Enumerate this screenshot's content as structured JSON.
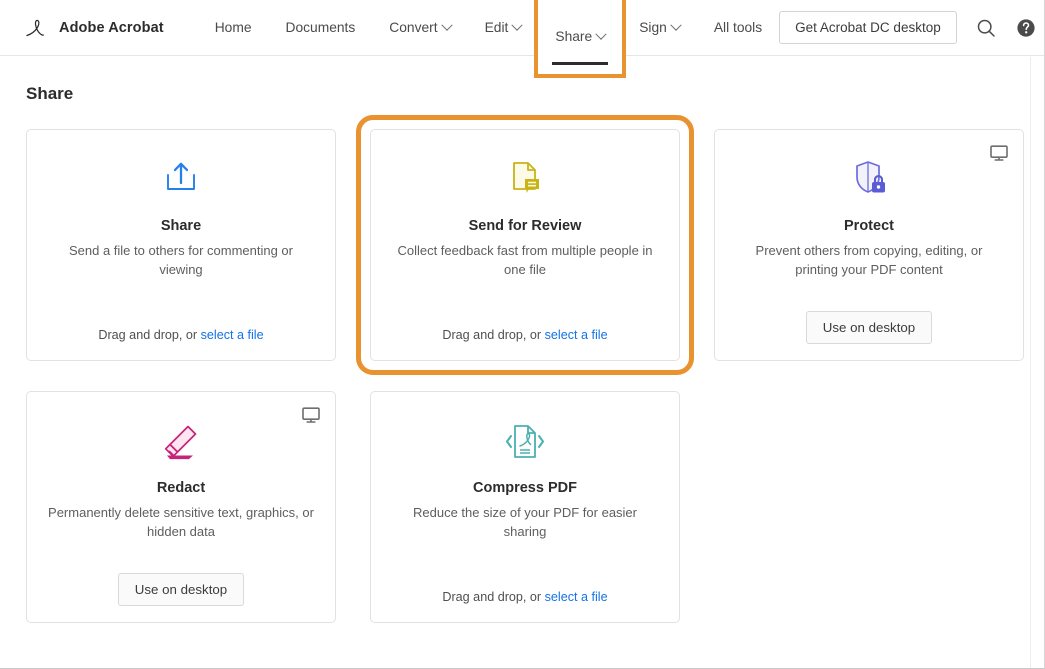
{
  "header": {
    "brand": {
      "logo_icon": "acrobat-logo-icon",
      "name": "Adobe Acrobat"
    },
    "nav": [
      {
        "label": "Home",
        "has_caret": false,
        "active": false,
        "highlighted": false
      },
      {
        "label": "Documents",
        "has_caret": false,
        "active": false,
        "highlighted": false
      },
      {
        "label": "Convert",
        "has_caret": true,
        "active": false,
        "highlighted": false
      },
      {
        "label": "Edit",
        "has_caret": true,
        "active": false,
        "highlighted": false
      },
      {
        "label": "Share",
        "has_caret": true,
        "active": true,
        "highlighted": true
      },
      {
        "label": "Sign",
        "has_caret": true,
        "active": false,
        "highlighted": false
      },
      {
        "label": "All tools",
        "has_caret": false,
        "active": false,
        "highlighted": false
      }
    ],
    "desktop_cta": "Get Acrobat DC desktop",
    "icons": {
      "search": "search-icon",
      "help": "help-icon",
      "notifications": "bell-icon",
      "avatar": "user-avatar"
    }
  },
  "main": {
    "title": "Share",
    "cards": [
      {
        "id": "share",
        "icon": "upload-share-icon",
        "title": "Share",
        "description": "Send a file to others for commenting or viewing",
        "footer_type": "dropzone",
        "dnd_text": "Drag and drop, or ",
        "dnd_link": "select a file",
        "desktop_badge": false,
        "highlighted": false
      },
      {
        "id": "send-for-review",
        "icon": "document-comment-icon",
        "title": "Send for Review",
        "description": "Collect feedback fast from multiple people in one file",
        "footer_type": "dropzone",
        "dnd_text": "Drag and drop, or ",
        "dnd_link": "select a file",
        "desktop_badge": false,
        "highlighted": true
      },
      {
        "id": "protect",
        "icon": "shield-lock-icon",
        "title": "Protect",
        "description": "Prevent others from copying, editing, or printing your PDF content",
        "footer_type": "button",
        "button_label": "Use on desktop",
        "desktop_badge": true,
        "badge_icon": "monitor-icon",
        "highlighted": false
      },
      {
        "id": "redact",
        "icon": "highlighter-marker-icon",
        "title": "Redact",
        "description": "Permanently delete sensitive text, graphics, or hidden data",
        "footer_type": "button",
        "button_label": "Use on desktop",
        "desktop_badge": true,
        "badge_icon": "monitor-icon",
        "highlighted": false
      },
      {
        "id": "compress-pdf",
        "icon": "compress-pdf-icon",
        "title": "Compress PDF",
        "description": "Reduce the size of your PDF for easier sharing",
        "footer_type": "dropzone",
        "dnd_text": "Drag and drop, or ",
        "dnd_link": "select a file",
        "desktop_badge": false,
        "highlighted": false
      }
    ]
  },
  "colors": {
    "highlight_orange": "#e8932f",
    "link_blue": "#1473e6",
    "share_icon_blue": "#2680eb",
    "review_icon_yellow": "#c9b416",
    "protect_icon_purple": "#6c6ce0",
    "redact_icon_pink": "#c5247a",
    "compress_icon_teal": "#49b0b0",
    "avatar_cyan": "#12b5ea",
    "text_dark": "#2c2c2c",
    "text_muted": "#5e5e5e"
  }
}
